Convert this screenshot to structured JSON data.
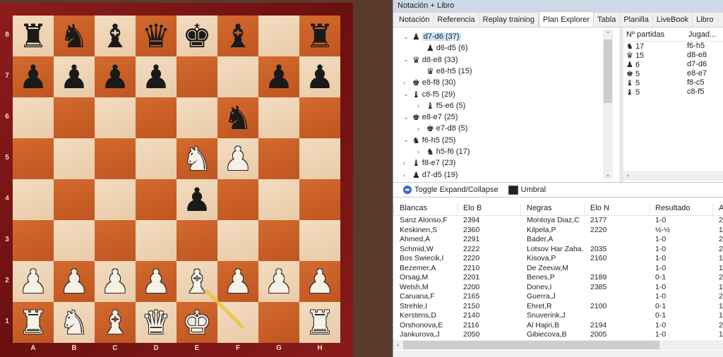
{
  "board": {
    "files": [
      "A",
      "B",
      "C",
      "D",
      "E",
      "F",
      "G",
      "H"
    ],
    "ranks": [
      "8",
      "7",
      "6",
      "5",
      "4",
      "3",
      "2",
      "1"
    ],
    "position": [
      [
        "bR",
        "bN",
        "bB",
        "bQ",
        "bK",
        "bB",
        "",
        "bR"
      ],
      [
        "bP",
        "bP",
        "bP",
        "bP",
        "",
        "",
        "bP",
        "bP"
      ],
      [
        "",
        "",
        "",
        "",
        "",
        "bN",
        "",
        ""
      ],
      [
        "",
        "",
        "",
        "",
        "wN",
        "wP",
        "",
        ""
      ],
      [
        "",
        "",
        "",
        "",
        "bP",
        "",
        "",
        ""
      ],
      [
        "",
        "",
        "",
        "",
        "",
        "",
        "",
        ""
      ],
      [
        "wP",
        "wP",
        "wP",
        "wP",
        "wB",
        "wP",
        "wP",
        "wP"
      ],
      [
        "wR",
        "wN",
        "wB",
        "wQ",
        "wK",
        "",
        "",
        "wR"
      ]
    ],
    "arrow": {
      "from": "f1",
      "to": "e2",
      "color": "#e8c030"
    },
    "light_color": "#efd6b8",
    "dark_color": "#c95e26"
  },
  "panel": {
    "title": "Notación + Libro",
    "tabs": [
      "Notación",
      "Referencia",
      "Replay training",
      "Plan Explorer",
      "Tabla",
      "Planilla",
      "LiveBook",
      "Libro"
    ],
    "active_tab": "Plan Explorer",
    "tree": [
      {
        "label": "d7-d6 (37)",
        "piece": "pawn",
        "level": 0,
        "toggle": "expanded",
        "selected": true
      },
      {
        "label": "d6-d5 (6)",
        "piece": "pawn",
        "level": 1,
        "toggle": "none"
      },
      {
        "label": "d8-e8 (33)",
        "piece": "queen",
        "level": 0,
        "toggle": "expanded"
      },
      {
        "label": "e8-h5 (15)",
        "piece": "queen",
        "level": 1,
        "toggle": "none"
      },
      {
        "label": "e8-f8 (30)",
        "piece": "king",
        "level": 0,
        "toggle": "collapsed"
      },
      {
        "label": "c8-f5 (29)",
        "piece": "bishop",
        "level": 0,
        "toggle": "expanded"
      },
      {
        "label": "f5-e6 (5)",
        "piece": "bishop",
        "level": 1,
        "toggle": "collapsed"
      },
      {
        "label": "e8-e7 (25)",
        "piece": "king",
        "level": 0,
        "toggle": "expanded"
      },
      {
        "label": "e7-d8 (5)",
        "piece": "king",
        "level": 1,
        "toggle": "collapsed"
      },
      {
        "label": "f6-h5 (25)",
        "piece": "knight",
        "level": 0,
        "toggle": "expanded"
      },
      {
        "label": "h5-f6 (17)",
        "piece": "knight",
        "level": 1,
        "toggle": "collapsed"
      },
      {
        "label": "f8-e7 (23)",
        "piece": "bishop",
        "level": 0,
        "toggle": "collapsed"
      },
      {
        "label": "d7-d5 (19)",
        "piece": "pawn",
        "level": 0,
        "toggle": "collapsed"
      }
    ],
    "moves": {
      "headers": [
        "Nº partidas",
        "Jugad..."
      ],
      "rows": [
        {
          "piece": "knight",
          "count": "17",
          "move": "f6-h5"
        },
        {
          "piece": "queen",
          "count": "15",
          "move": "d8-e8"
        },
        {
          "piece": "pawn",
          "count": "6",
          "move": "d7-d6"
        },
        {
          "piece": "king",
          "count": "5",
          "move": "e8-e7"
        },
        {
          "piece": "bishop",
          "count": "5",
          "move": "f8-c5"
        },
        {
          "piece": "bishop",
          "count": "5",
          "move": "c8-f5"
        }
      ]
    },
    "toolbar": {
      "toggle": "Toggle Expand/Collapse",
      "threshold": "Umbral"
    },
    "games": {
      "headers": [
        "Blancas",
        "Elo B",
        "Negras",
        "Elo N",
        "Resultado",
        "A"
      ],
      "rows": [
        [
          "Sanz Alonso,F",
          "2394",
          "Montoya Diaz,C",
          "2177",
          "1-0",
          "2"
        ],
        [
          "Keskinen,S",
          "2360",
          "Kilpela,P",
          "2220",
          "½-½",
          "1"
        ],
        [
          "Ahmed,A",
          "2291",
          "Bader,A",
          "",
          "1-0",
          "2"
        ],
        [
          "Schmid,W",
          "2222",
          "Lotsov Har Zaha..",
          "2035",
          "1-0",
          "2"
        ],
        [
          "Bos Swiecik,I",
          "2220",
          "Kisova,P",
          "2160",
          "1-0",
          "1"
        ],
        [
          "Bezemer,A",
          "2210",
          "De Zeeuw,M",
          "",
          "1-0",
          "1"
        ],
        [
          "Orsag,M",
          "2201",
          "Benes,P",
          "2189",
          "0-1",
          "2"
        ],
        [
          "Welsh,M",
          "2200",
          "Donev,I",
          "2385",
          "1-0",
          "1"
        ],
        [
          "Caruana,F",
          "2165",
          "Guerra,J",
          "",
          "1-0",
          "2"
        ],
        [
          "Strehle,I",
          "2150",
          "Ehret,R",
          "2100",
          "0-1",
          "1"
        ],
        [
          "Kerstens,D",
          "2140",
          "Snuverink,J",
          "",
          "0-1",
          "1"
        ],
        [
          "Orshonova,E",
          "2116",
          "Al Hajiri,B",
          "2194",
          "1-0",
          "2"
        ],
        [
          "Jankurova,J",
          "2050",
          "Gibiecova,B",
          "2005",
          "1-0",
          "1"
        ]
      ]
    }
  }
}
